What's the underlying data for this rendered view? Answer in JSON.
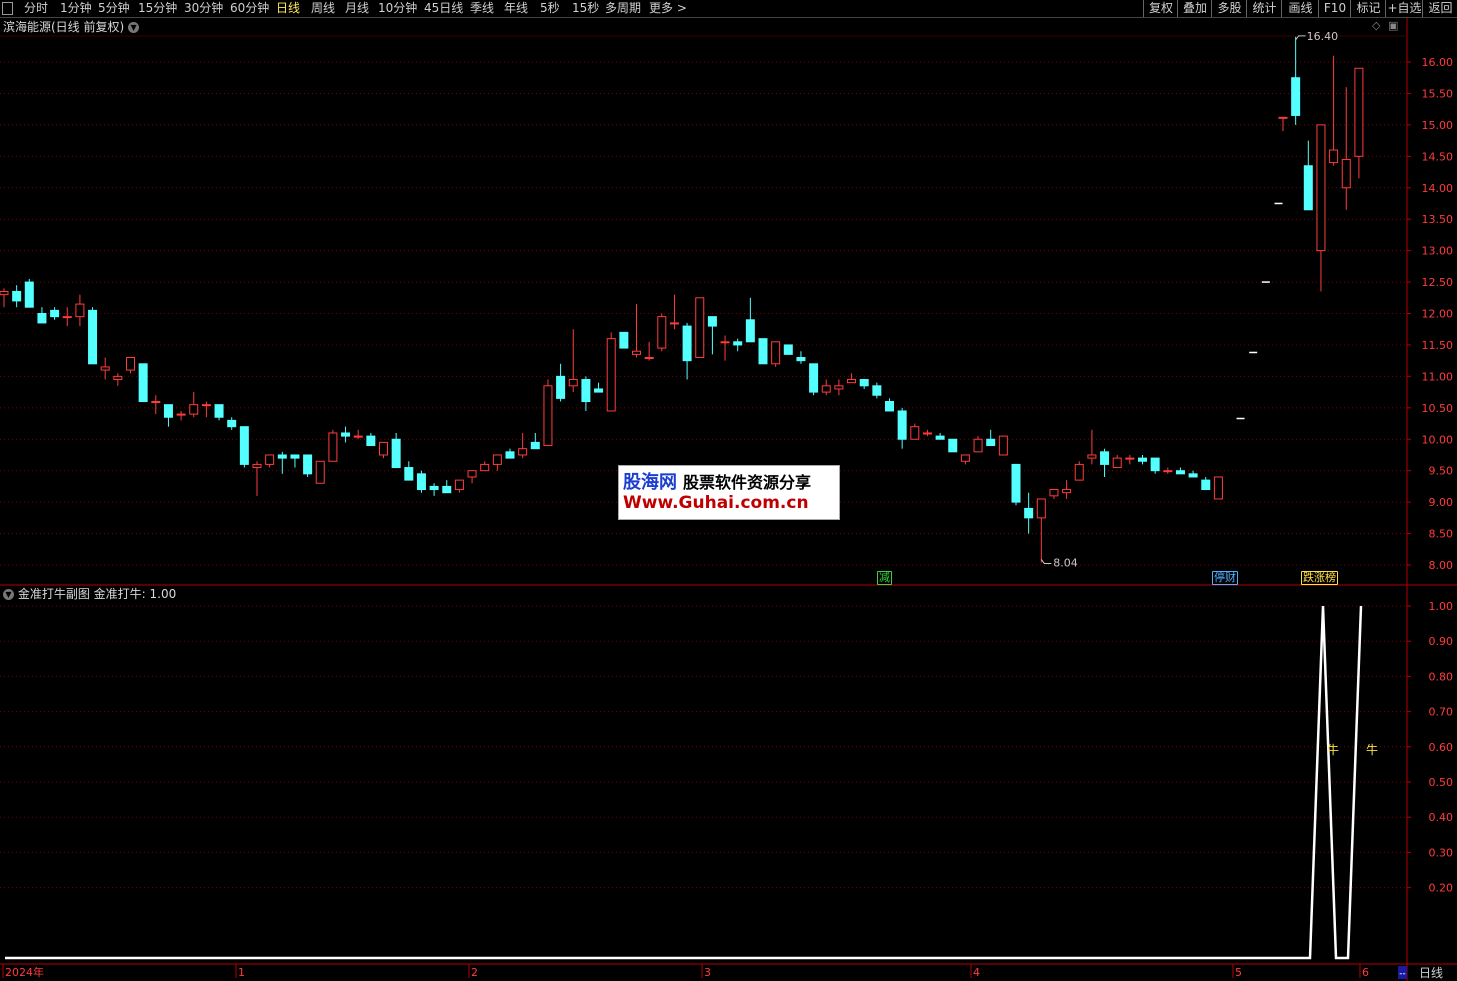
{
  "toolbar": {
    "menu_icon": "menu-icon",
    "periods": [
      {
        "label": "分时",
        "active": false
      },
      {
        "label": "1分钟",
        "active": false
      },
      {
        "label": "5分钟",
        "active": false
      },
      {
        "label": "15分钟",
        "active": false
      },
      {
        "label": "30分钟",
        "active": false
      },
      {
        "label": "60分钟",
        "active": false
      },
      {
        "label": "日线",
        "active": true
      },
      {
        "label": "周线",
        "active": false
      },
      {
        "label": "月线",
        "active": false
      },
      {
        "label": "10分钟",
        "active": false
      },
      {
        "label": "45日线",
        "active": false
      },
      {
        "label": "季线",
        "active": false
      },
      {
        "label": "年线",
        "active": false
      },
      {
        "label": "5秒",
        "active": false
      },
      {
        "label": "15秒",
        "active": false
      },
      {
        "label": "多周期",
        "active": false
      },
      {
        "label": "更多 >",
        "active": false
      }
    ],
    "right_buttons": [
      "复权",
      "叠加",
      "多股",
      "统计",
      "画线",
      "F10",
      "标记",
      "+自选",
      "返回"
    ]
  },
  "main_panel": {
    "title": "滨海能源(日线 前复权)",
    "high_label": "16.40",
    "low_label": "8.04",
    "price_axis": [
      "16.00",
      "15.50",
      "15.00",
      "14.50",
      "14.00",
      "13.50",
      "13.00",
      "12.50",
      "12.00",
      "11.50",
      "11.00",
      "10.50",
      "10.00",
      "9.50",
      "9.00",
      "8.50",
      "8.00"
    ],
    "tags": [
      {
        "text": "减",
        "color": "#3ad23a"
      },
      {
        "text": "停财",
        "color": "#4fb0ff"
      },
      {
        "text": "跌涨榜",
        "color": "#ffe040"
      }
    ]
  },
  "sub_panel": {
    "title": "金准打牛副图 金准打牛: 1.00",
    "axis": [
      "1.00",
      "0.90",
      "0.80",
      "0.70",
      "0.60",
      "0.50",
      "0.40",
      "0.30",
      "0.20"
    ],
    "signal_label": "牛"
  },
  "time_axis": {
    "labels": [
      "2024年",
      "1",
      "2",
      "3",
      "4",
      "5",
      "6"
    ],
    "period_label": "日线"
  },
  "watermark": {
    "brand": "股海网",
    "slogan": "股票软件资源分享",
    "url": "Www.Guhai.com.cn"
  },
  "colors": {
    "up": "#ff3c3c",
    "down": "#54ffff",
    "grid": "#7a0000",
    "axis_text": "#ff3c3c",
    "line": "#ffffff"
  },
  "chart_data": {
    "type": "candlestick",
    "ohlc": [
      [
        12.3,
        12.4,
        12.1,
        12.35
      ],
      [
        12.35,
        12.45,
        12.1,
        12.2
      ],
      [
        12.5,
        12.55,
        12.1,
        12.1
      ],
      [
        12.0,
        12.1,
        11.85,
        11.85
      ],
      [
        12.05,
        12.1,
        11.9,
        11.95
      ],
      [
        11.95,
        12.1,
        11.8,
        11.95
      ],
      [
        11.95,
        12.3,
        11.8,
        12.15
      ],
      [
        12.05,
        12.1,
        11.2,
        11.2
      ],
      [
        11.1,
        11.3,
        10.95,
        11.15
      ],
      [
        10.95,
        11.05,
        10.85,
        11.0
      ],
      [
        11.1,
        11.3,
        11.05,
        11.3
      ],
      [
        11.2,
        11.2,
        10.6,
        10.6
      ],
      [
        10.6,
        10.7,
        10.4,
        10.6
      ],
      [
        10.55,
        10.55,
        10.2,
        10.35
      ],
      [
        10.4,
        10.45,
        10.3,
        10.4
      ],
      [
        10.4,
        10.75,
        10.35,
        10.55
      ],
      [
        10.55,
        10.6,
        10.35,
        10.55
      ],
      [
        10.55,
        10.55,
        10.3,
        10.35
      ],
      [
        10.3,
        10.35,
        10.15,
        10.2
      ],
      [
        10.2,
        10.2,
        9.55,
        9.6
      ],
      [
        9.55,
        9.65,
        9.1,
        9.6
      ],
      [
        9.6,
        9.75,
        9.55,
        9.75
      ],
      [
        9.75,
        9.8,
        9.45,
        9.7
      ],
      [
        9.75,
        9.75,
        9.55,
        9.7
      ],
      [
        9.75,
        9.75,
        9.4,
        9.45
      ],
      [
        9.3,
        9.65,
        9.3,
        9.65
      ],
      [
        9.65,
        10.15,
        9.65,
        10.1
      ],
      [
        10.1,
        10.2,
        9.95,
        10.05
      ],
      [
        10.05,
        10.15,
        10.0,
        10.05
      ],
      [
        10.05,
        10.1,
        9.9,
        9.9
      ],
      [
        9.75,
        9.95,
        9.7,
        9.95
      ],
      [
        10.0,
        10.1,
        9.55,
        9.55
      ],
      [
        9.55,
        9.65,
        9.35,
        9.35
      ],
      [
        9.45,
        9.5,
        9.15,
        9.2
      ],
      [
        9.25,
        9.3,
        9.1,
        9.2
      ],
      [
        9.25,
        9.35,
        9.15,
        9.15
      ],
      [
        9.2,
        9.35,
        9.15,
        9.35
      ],
      [
        9.4,
        9.5,
        9.3,
        9.5
      ],
      [
        9.5,
        9.65,
        9.5,
        9.6
      ],
      [
        9.6,
        9.75,
        9.5,
        9.75
      ],
      [
        9.8,
        9.85,
        9.7,
        9.7
      ],
      [
        9.75,
        10.1,
        9.7,
        9.85
      ],
      [
        9.95,
        10.1,
        9.85,
        9.85
      ],
      [
        9.9,
        10.95,
        9.9,
        10.85
      ],
      [
        11.0,
        11.2,
        10.6,
        10.65
      ],
      [
        10.85,
        11.75,
        10.75,
        10.95
      ],
      [
        10.95,
        11.0,
        10.45,
        10.6
      ],
      [
        10.8,
        10.9,
        10.75,
        10.75
      ],
      [
        10.45,
        11.7,
        10.45,
        11.6
      ],
      [
        11.7,
        11.7,
        11.45,
        11.45
      ],
      [
        11.35,
        12.15,
        11.3,
        11.4
      ],
      [
        11.3,
        11.55,
        11.25,
        11.3
      ],
      [
        11.45,
        12.0,
        11.4,
        11.95
      ],
      [
        11.85,
        12.3,
        11.75,
        11.85
      ],
      [
        11.8,
        11.85,
        10.95,
        11.25
      ],
      [
        11.3,
        12.25,
        11.3,
        12.25
      ],
      [
        11.95,
        11.95,
        11.35,
        11.8
      ],
      [
        11.55,
        11.65,
        11.25,
        11.55
      ],
      [
        11.55,
        11.6,
        11.4,
        11.5
      ],
      [
        11.9,
        12.25,
        11.55,
        11.55
      ],
      [
        11.6,
        11.6,
        11.2,
        11.2
      ],
      [
        11.2,
        11.55,
        11.15,
        11.55
      ],
      [
        11.5,
        11.5,
        11.35,
        11.35
      ],
      [
        11.3,
        11.4,
        11.2,
        11.25
      ],
      [
        11.2,
        11.2,
        10.7,
        10.75
      ],
      [
        10.75,
        10.95,
        10.7,
        10.85
      ],
      [
        10.8,
        10.95,
        10.7,
        10.85
      ],
      [
        10.9,
        11.05,
        10.9,
        10.95
      ],
      [
        10.95,
        10.95,
        10.8,
        10.85
      ],
      [
        10.85,
        10.9,
        10.65,
        10.7
      ],
      [
        10.6,
        10.65,
        10.45,
        10.45
      ],
      [
        10.45,
        10.5,
        9.85,
        10.0
      ],
      [
        10.0,
        10.25,
        10.0,
        10.2
      ],
      [
        10.1,
        10.15,
        10.05,
        10.1
      ],
      [
        10.05,
        10.1,
        10.0,
        10.0
      ],
      [
        10.0,
        10.0,
        9.8,
        9.8
      ],
      [
        9.65,
        9.75,
        9.6,
        9.75
      ],
      [
        9.8,
        10.05,
        9.8,
        10.0
      ],
      [
        10.0,
        10.15,
        9.9,
        9.9
      ],
      [
        9.75,
        10.05,
        9.75,
        10.05
      ],
      [
        9.6,
        9.6,
        8.95,
        9.0
      ],
      [
        8.9,
        9.15,
        8.5,
        8.75
      ],
      [
        8.75,
        9.05,
        8.04,
        9.05
      ],
      [
        9.1,
        9.2,
        9.05,
        9.2
      ],
      [
        9.15,
        9.35,
        9.05,
        9.2
      ],
      [
        9.35,
        9.65,
        9.35,
        9.6
      ],
      [
        9.7,
        10.15,
        9.6,
        9.75
      ],
      [
        9.8,
        9.85,
        9.4,
        9.6
      ],
      [
        9.55,
        9.75,
        9.55,
        9.7
      ],
      [
        9.7,
        9.75,
        9.6,
        9.7
      ],
      [
        9.7,
        9.75,
        9.6,
        9.65
      ],
      [
        9.7,
        9.7,
        9.45,
        9.5
      ],
      [
        9.5,
        9.55,
        9.45,
        9.5
      ],
      [
        9.5,
        9.55,
        9.45,
        9.45
      ],
      [
        9.45,
        9.5,
        9.4,
        9.4
      ],
      [
        9.35,
        9.4,
        9.2,
        9.2
      ],
      [
        9.05,
        9.4,
        9.05,
        9.4
      ]
    ],
    "limit_days": [
      10.33,
      11.38,
      12.5,
      13.75
    ],
    "tail_ohlc": [
      [
        15.12,
        15.12,
        14.9,
        15.12
      ],
      [
        15.75,
        16.4,
        15.0,
        15.15
      ],
      [
        14.35,
        14.75,
        13.65,
        13.65
      ],
      [
        13.0,
        15.0,
        12.35,
        15.0
      ],
      [
        14.4,
        16.1,
        14.35,
        14.6
      ],
      [
        14.0,
        15.6,
        13.65,
        14.45
      ],
      [
        14.5,
        15.9,
        14.15,
        15.9
      ]
    ],
    "price_min": 8.0,
    "price_max": 16.0,
    "indicator": {
      "name": "金准打牛",
      "ymin": 0.0,
      "ymax": 1.0,
      "values": [
        0,
        0,
        1,
        0,
        0,
        1
      ]
    }
  }
}
